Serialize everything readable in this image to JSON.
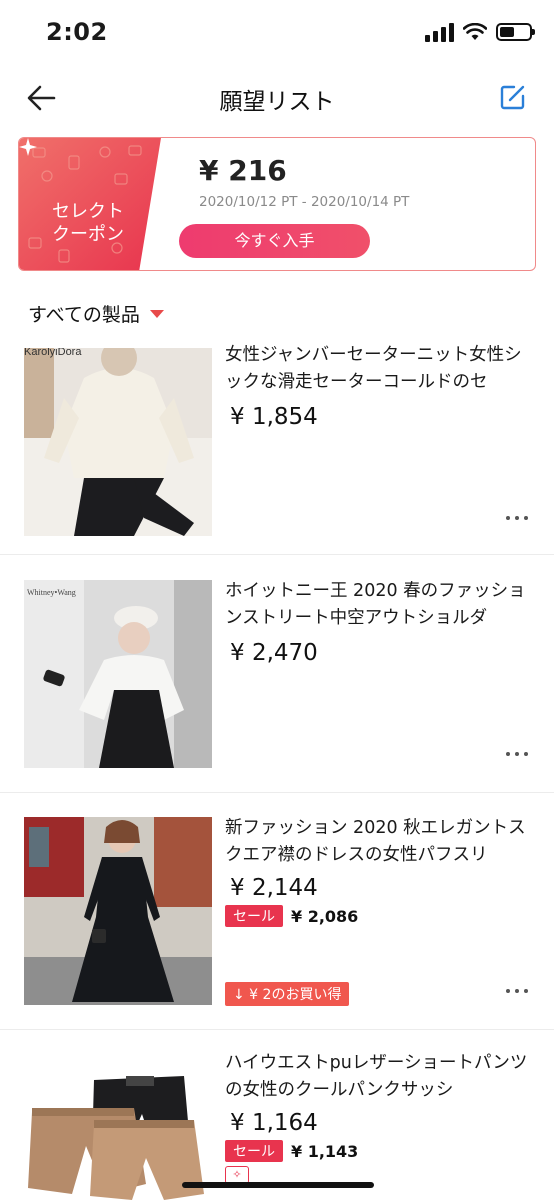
{
  "status_bar": {
    "time": "2:02"
  },
  "nav": {
    "title": "願望リスト"
  },
  "coupon": {
    "label_line1": "セレクト",
    "label_line2": "クーポン",
    "amount": "¥ 216",
    "dates": "2020/10/12 PT - 2020/10/14 PT",
    "button": "今すぐ入手",
    "color_gradient_start": "#f0706a",
    "color_gradient_end": "#e8344e"
  },
  "filter": {
    "label": "すべての製品"
  },
  "products": [
    {
      "title": "女性ジャンバーセーターニット女性シックな滑走セーターコールドのセ",
      "price": "¥ 1,854",
      "image_brand": "KarolyiDora"
    },
    {
      "title": "ホイットニー王 2020 春のファッションストリート中空アウトショルダ",
      "price": "¥ 2,470",
      "image_brand": "Whitney•Wang"
    },
    {
      "title": "新ファッション 2020 秋エレガントスクエア襟のドレスの女性パフスリ",
      "price": "¥ 2,144",
      "sale_badge": "セール",
      "sale_price": "¥ 2,086",
      "saving": "↓ ¥ 2のお買い得"
    },
    {
      "title": "ハイウエストpuレザーショートパンツの女性のクールパンクサッシ",
      "price": "¥ 1,164",
      "sale_badge": "セール",
      "sale_price": "¥ 1,143"
    }
  ],
  "colors": {
    "accent": "#e8344e",
    "button_pink": "#ee3b6f",
    "caret": "#e84a4a",
    "edit_icon": "#2a7fd8"
  }
}
